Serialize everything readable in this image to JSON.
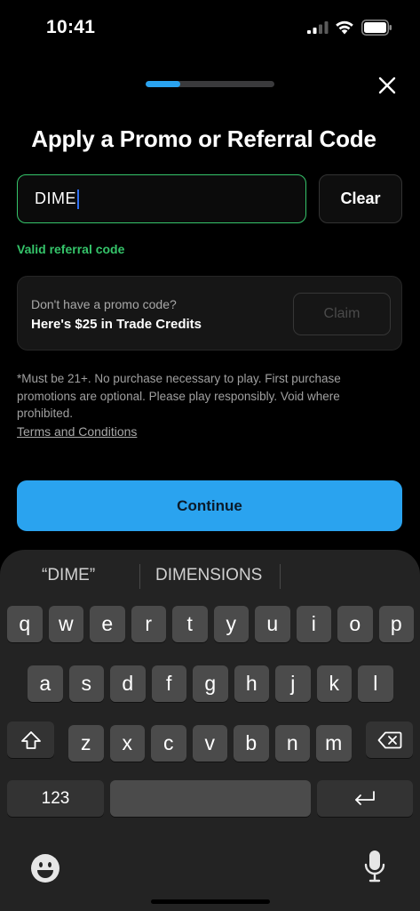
{
  "status_bar": {
    "time": "10:41"
  },
  "progress": {
    "fraction": 0.27
  },
  "page": {
    "title": "Apply a Promo or Referral Code"
  },
  "code_input": {
    "value": "DIME",
    "clear_label": "Clear",
    "valid_message": "Valid referral code"
  },
  "promo_card": {
    "question": "Don't have a promo code?",
    "offer": "Here's $25 in Trade Credits",
    "claim_label": "Claim"
  },
  "disclaimer": "*Must be 21+. No purchase necessary to play. First purchase promotions are optional. Please play responsibly. Void where prohibited.",
  "terms_label": "Terms and Conditions",
  "continue_label": "Continue",
  "colors": {
    "accent": "#2aa3ef",
    "success": "#35c46a",
    "background": "#000000"
  },
  "keyboard": {
    "suggestions": [
      "“DIME”",
      "DIMENSIONS"
    ],
    "row1": [
      "q",
      "w",
      "e",
      "r",
      "t",
      "y",
      "u",
      "i",
      "o",
      "p"
    ],
    "row2": [
      "a",
      "s",
      "d",
      "f",
      "g",
      "h",
      "j",
      "k",
      "l"
    ],
    "row3": [
      "z",
      "x",
      "c",
      "v",
      "b",
      "n",
      "m"
    ],
    "numbers_label": "123",
    "icons": {
      "shift": "shift-icon",
      "delete": "delete-icon",
      "return": "return-icon",
      "emoji": "emoji-icon",
      "mic": "microphone-icon"
    }
  }
}
